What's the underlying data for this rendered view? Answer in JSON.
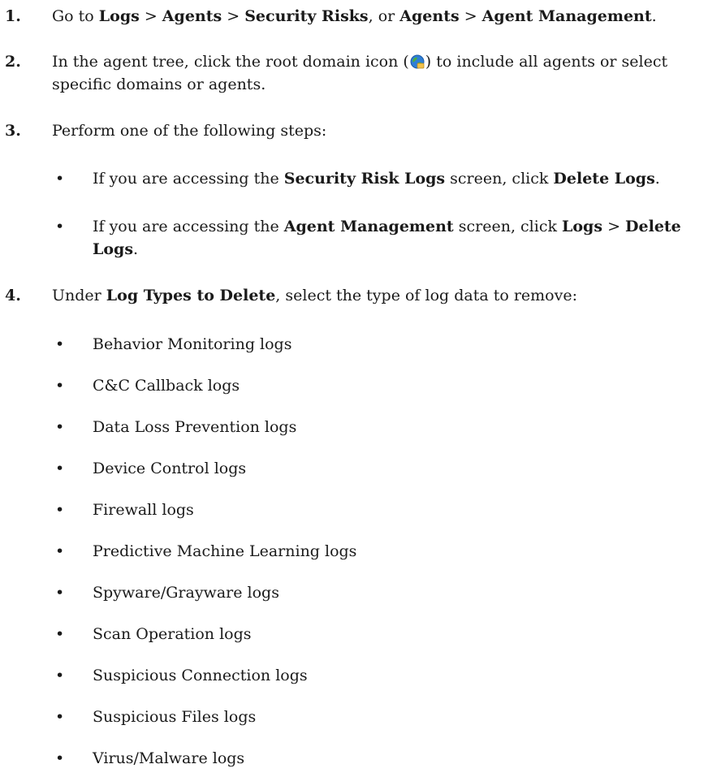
{
  "steps": [
    {
      "number": "1.",
      "parts": [
        {
          "t": "Go to ",
          "b": false
        },
        {
          "t": "Logs",
          "b": true
        },
        {
          "t": " > ",
          "b": false
        },
        {
          "t": "Agents",
          "b": true
        },
        {
          "t": " > ",
          "b": false
        },
        {
          "t": "Security Risks",
          "b": true
        },
        {
          "t": ", or ",
          "b": false
        },
        {
          "t": "Agents",
          "b": true
        },
        {
          "t": " > ",
          "b": false
        },
        {
          "t": "Agent Management",
          "b": true
        },
        {
          "t": ".",
          "b": false
        }
      ]
    },
    {
      "number": "2.",
      "line1_before_icon": "In the agent tree, click the root domain icon (",
      "icon": "root-domain-globe-icon",
      "line1_after_icon": ") to include all agents or select",
      "line2": "specific domains or agents."
    },
    {
      "number": "3.",
      "text": "Perform one of the following steps:",
      "bullets": [
        {
          "parts": [
            {
              "t": "If you are accessing the ",
              "b": false
            },
            {
              "t": "Security Risk Logs",
              "b": true
            },
            {
              "t": " screen, click ",
              "b": false
            },
            {
              "t": "Delete Logs",
              "b": true
            },
            {
              "t": ".",
              "b": false
            }
          ]
        },
        {
          "line1": [
            {
              "t": "If you are accessing the ",
              "b": false
            },
            {
              "t": "Agent Management",
              "b": true
            },
            {
              "t": " screen, click ",
              "b": false
            },
            {
              "t": "Logs",
              "b": true
            },
            {
              "t": " > ",
              "b": false
            },
            {
              "t": "Delete",
              "b": true
            }
          ],
          "line2": [
            {
              "t": "Logs",
              "b": true
            },
            {
              "t": ".",
              "b": false
            }
          ]
        }
      ]
    },
    {
      "number": "4.",
      "parts": [
        {
          "t": "Under ",
          "b": false
        },
        {
          "t": "Log Types to Delete",
          "b": true
        },
        {
          "t": ", select the type of log data to remove:",
          "b": false
        }
      ],
      "log_types": [
        "Behavior Monitoring logs",
        "C&C Callback logs",
        "Data Loss Prevention logs",
        "Device Control logs",
        "Firewall logs",
        "Predictive Machine Learning logs",
        "Spyware/Grayware logs",
        "Scan Operation logs",
        "Suspicious Connection logs",
        "Suspicious Files logs",
        "Virus/Malware logs"
      ]
    }
  ],
  "bullet_glyph": "•",
  "icon_colors": {
    "globe_blue": "#2f7fd6",
    "globe_green": "#4caf3d",
    "folder_yellow": "#f2c24b"
  }
}
